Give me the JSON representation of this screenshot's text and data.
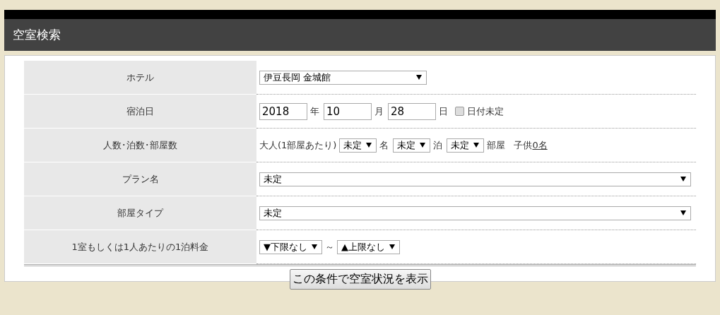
{
  "title": "空室検索",
  "rows": [
    {
      "kind": "select",
      "label": "ホテル",
      "value": "伊豆長岡 金城館"
    },
    {
      "kind": "date",
      "label": "宿泊日",
      "fields": [
        {
          "value": "2018",
          "unit": "年"
        },
        {
          "value": "10",
          "unit": "月"
        },
        {
          "value": "28",
          "unit": "日"
        }
      ],
      "checkbox": {
        "label": "日付未定",
        "checked": false
      }
    },
    {
      "kind": "counts",
      "label": "人数･泊数･部屋数",
      "lead": "大人(1部屋あたり)",
      "selects": [
        {
          "value": "未定",
          "unit": "名"
        },
        {
          "value": "未定",
          "unit": "泊"
        },
        {
          "value": "未定",
          "unit": "部屋"
        }
      ],
      "child_label": "子供",
      "child_link": "0名"
    },
    {
      "kind": "wideselect",
      "label": "プラン名",
      "value": "未定"
    },
    {
      "kind": "wideselect",
      "label": "部屋タイプ",
      "value": "未定"
    },
    {
      "kind": "range",
      "label": "1室もしくは1人あたりの1泊料金",
      "min": "▼下限なし",
      "separator": "～",
      "max": "▲上限なし"
    }
  ],
  "submit": "この条件で空室状況を表示"
}
